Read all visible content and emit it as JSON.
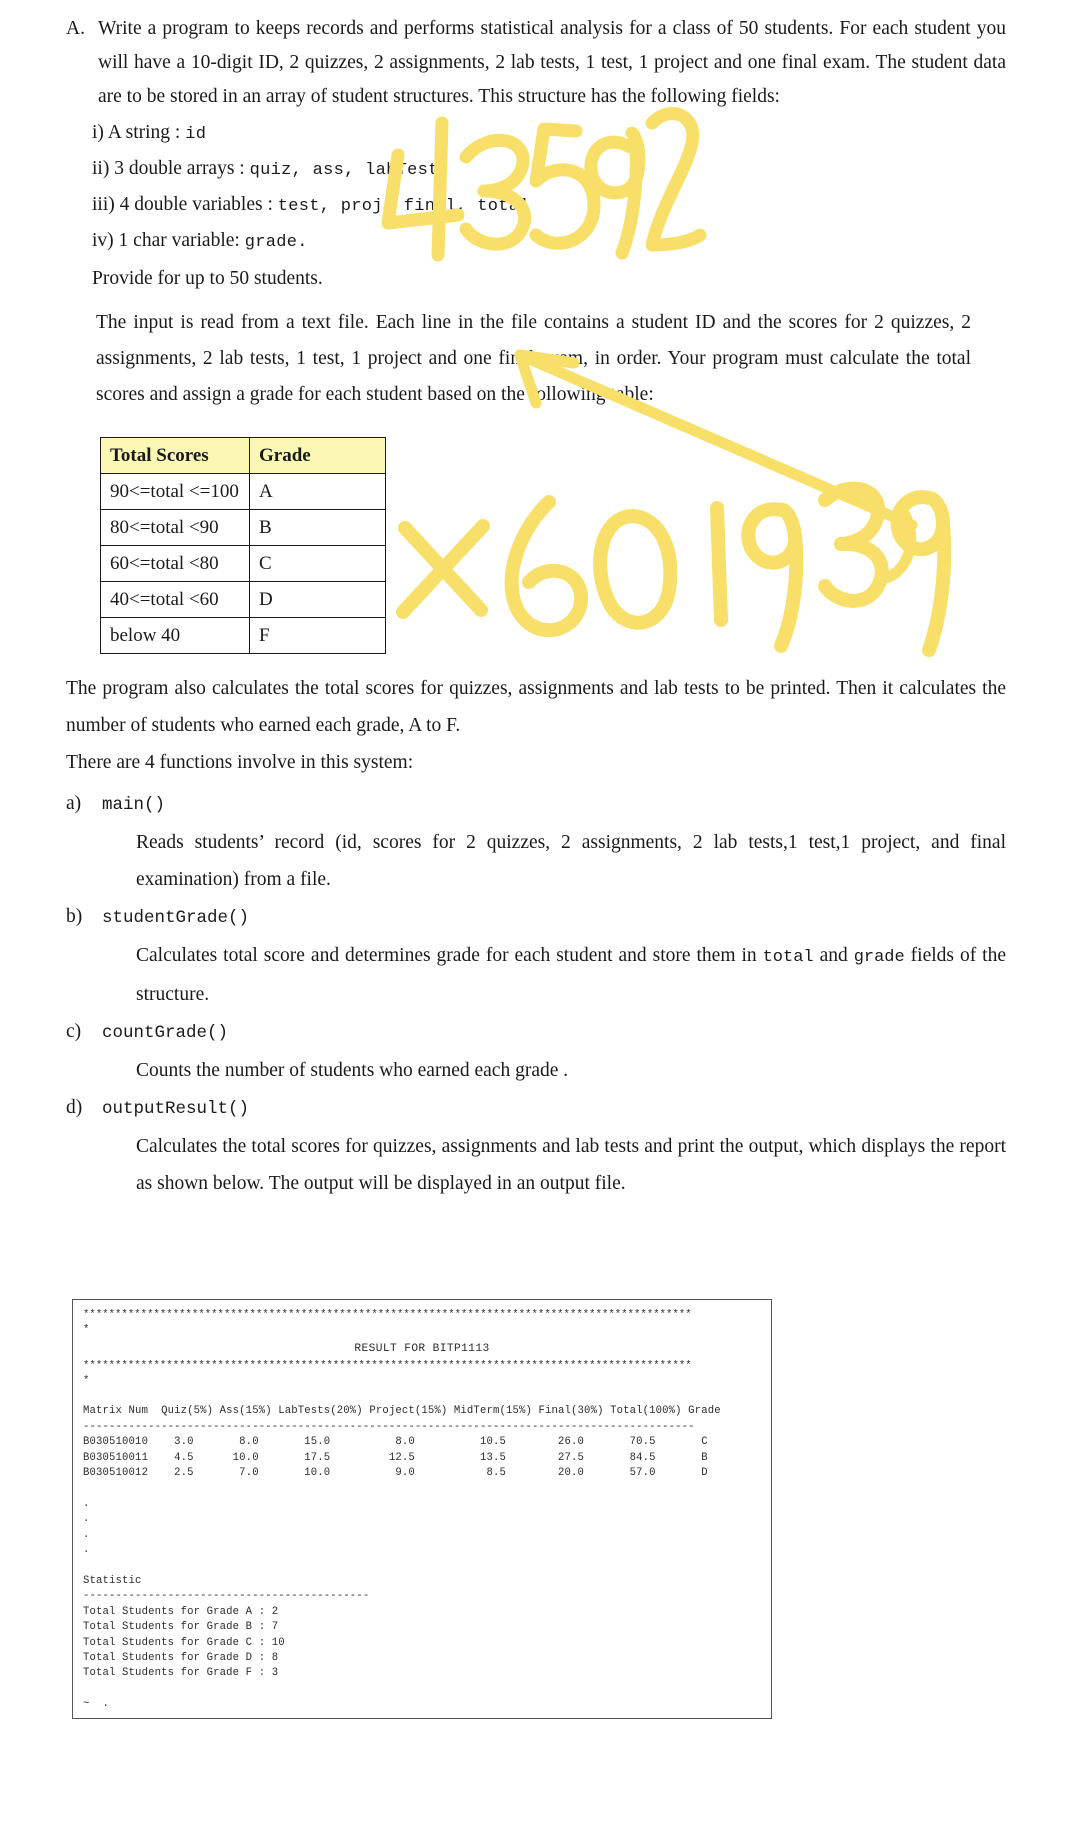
{
  "question": {
    "marker": "A.",
    "intro": "Write a program to keeps records and performs statistical analysis for a class of 50 students. For each student you will have a 10-digit ID, 2 quizzes, 2 assignments, 2 lab tests, 1 test, 1 project and one final exam. The student data are to be stored in an array of student structures. This structure has the following fields:",
    "fields": [
      {
        "marker": "i)",
        "text": "A string : ",
        "code": "id"
      },
      {
        "marker": "ii)",
        "text": "3 double arrays : ",
        "code": "quiz, ass, labTest"
      },
      {
        "marker": "iii)",
        "text": "4 double variables : ",
        "code": "test, proj, final, total"
      },
      {
        "marker": "iv)",
        "text": "1 char variable: ",
        "code": "grade."
      }
    ],
    "provide": "Provide for up to 50 students.",
    "input_para": "The input is read from a text file. Each line in the file contains a student ID and the scores for 2 quizzes, 2 assignments, 2 lab tests, 1 test, 1 project and one final exam, in order. Your program must calculate the total scores and assign a grade for each student based on the following table:"
  },
  "grade_table": {
    "headers": [
      "Total Scores",
      "Grade"
    ],
    "header_bg": "#fbf8b6",
    "rows": [
      [
        "90<=total <=100",
        "A"
      ],
      [
        "80<=total <90",
        "B"
      ],
      [
        "60<=total <80",
        "C"
      ],
      [
        "40<=total <60",
        "D"
      ],
      [
        "below 40",
        "F"
      ]
    ]
  },
  "middle": {
    "para_totals": "The program also calculates the total scores for quizzes, assignments and lab tests to be printed. Then it calculates the number of students who earned each grade, A to F.",
    "functions_intro": "There are 4 functions involve in this system:"
  },
  "functions": [
    {
      "marker": "a)",
      "name": "main()",
      "description": "Reads students’ record (id, scores for 2 quizzes, 2 assignments, 2 lab tests,1 test,1 project, and final examination) from a file."
    },
    {
      "marker": "b)",
      "name": "studentGrade()",
      "description_pre": "Calculates total score and determines grade for each student and store them in ",
      "code_1": "total",
      "description_mid": " and  ",
      "code_2": "grade",
      "description_post": " fields of the structure.",
      "description": "Calculates total score and determines grade for each student and store them in total and grade fields of the structure."
    },
    {
      "marker": "c)",
      "name": "countGrade()",
      "description": "Counts the number of students who earned each grade ."
    },
    {
      "marker": "d)",
      "name": "outputResult()",
      "description": "Calculates the total scores for quizzes, assignments and lab tests and print the output, which displays the report as shown below. The output will be displayed in an output file."
    }
  ],
  "console": {
    "star_line": "***********************************************************************************************",
    "dot": "*",
    "title": "RESULT FOR BITP1113",
    "header_line": "Matrix Num  Quiz(5%) Ass(15%) LabTests(20%) Project(15%) MidTerm(15%) Final(30%) Total(100%) Grade",
    "divider": "----------------------------------------------------------------------------------------------",
    "rows": [
      "B030510010    3.0       8.0       15.0          8.0          10.5        26.0       70.5       C",
      "B030510011    4.5      10.0       17.5         12.5          13.5        27.5       84.5       B",
      "B030510012    2.5       7.0       10.0          9.0           8.5        20.0       57.0       D"
    ],
    "ellipsis": [
      ".",
      ".",
      ".",
      "."
    ],
    "statistic_label": "Statistic",
    "statistic_divider": "--------------------------------------------",
    "statistic_rows": [
      "Total Students for Grade A : 2",
      "Total Students for Grade B : 7",
      "Total Students for Grade C : 10",
      "Total Students for Grade D : 8",
      "Total Students for Grade F : 3"
    ],
    "tail": "~  ."
  },
  "annotations": {
    "color": "#f7df6a",
    "top_text": "43592",
    "bottom_text": "x60 1939",
    "arrow": "arrow pointing up-left toward input paragraph"
  }
}
